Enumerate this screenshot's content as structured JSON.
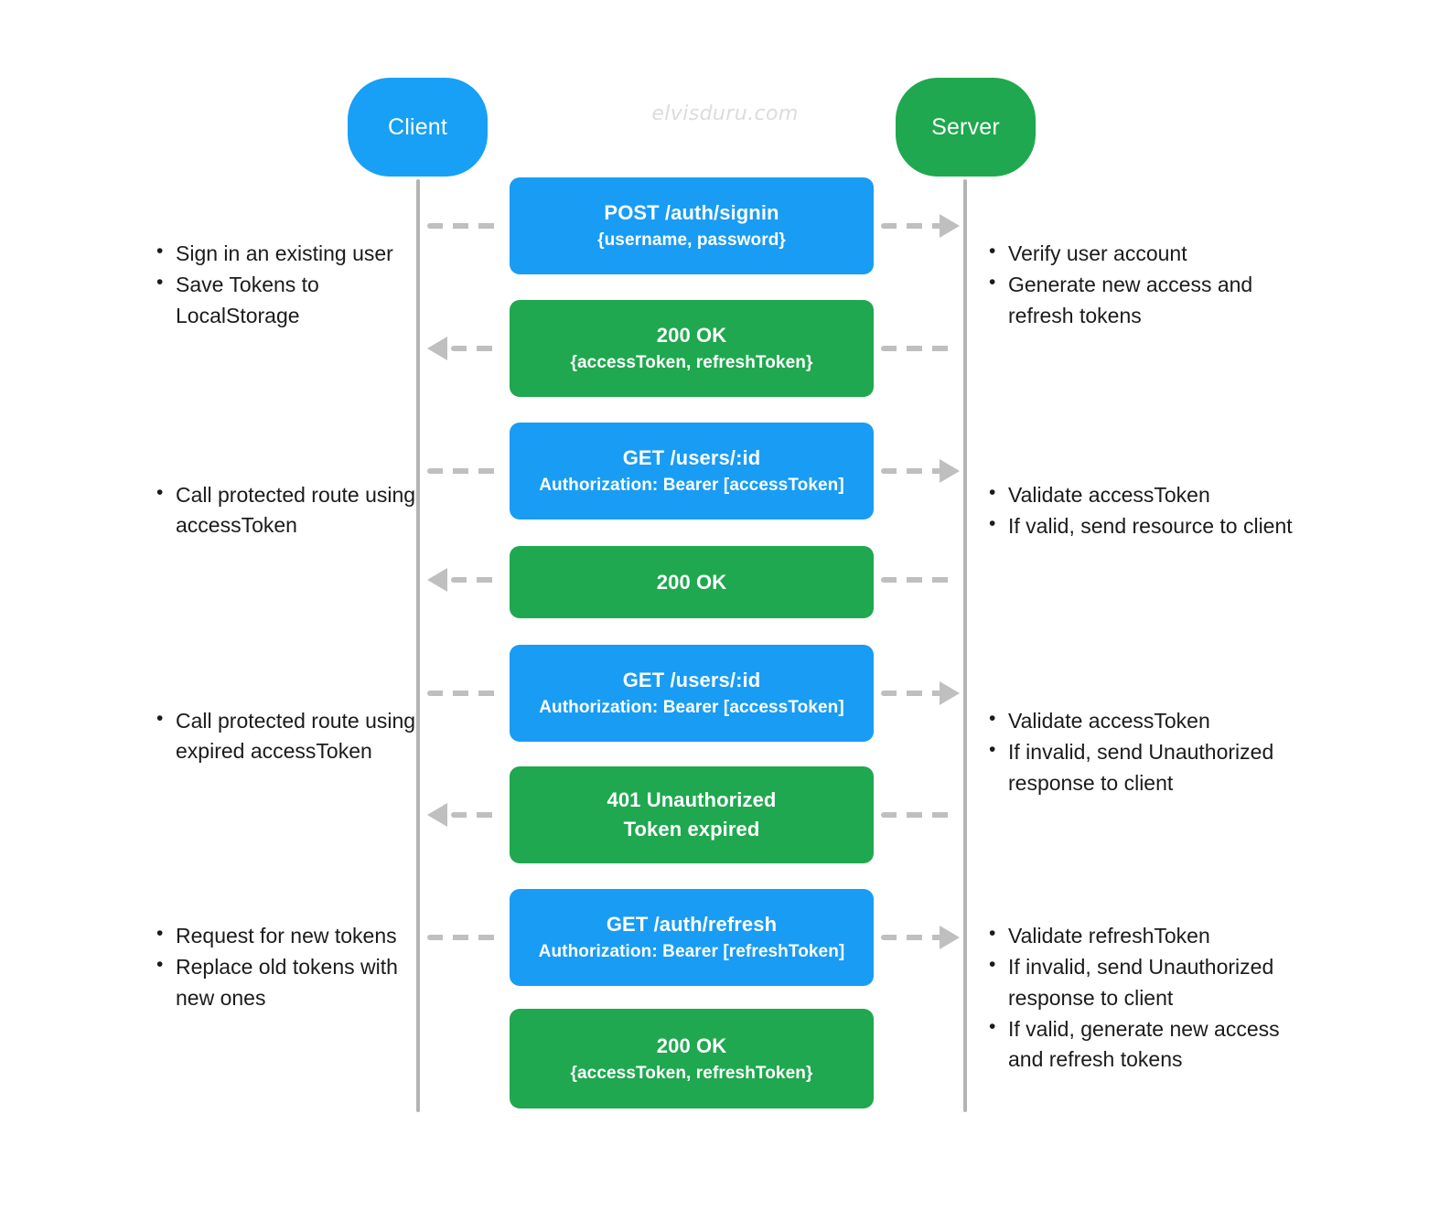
{
  "watermark": "elvisduru.com",
  "colors": {
    "client": "#17a0f5",
    "server": "#1fa84f",
    "request_box": "#199cf4",
    "response_box": "#1fa84f",
    "lifeline": "#b4b4b4",
    "arrow": "#bfbfbf",
    "text": "#1b1b1b"
  },
  "actors": {
    "client": "Client",
    "server": "Server"
  },
  "messages": [
    {
      "id": "signin-request",
      "kind": "request",
      "direction": "right",
      "line1": "POST /auth/signin",
      "line2": "{username, password}"
    },
    {
      "id": "signin-response",
      "kind": "response",
      "direction": "left",
      "line1": "200 OK",
      "line2": "{accessToken, refreshToken}"
    },
    {
      "id": "users-request-1",
      "kind": "request",
      "direction": "right",
      "line1": "GET /users/:id",
      "line2": "Authorization: Bearer [accessToken]"
    },
    {
      "id": "users-response-1",
      "kind": "response",
      "direction": "left",
      "line1": "200 OK",
      "line2": ""
    },
    {
      "id": "users-request-2",
      "kind": "request",
      "direction": "right",
      "line1": "GET /users/:id",
      "line2": "Authorization: Bearer [accessToken]"
    },
    {
      "id": "users-response-2",
      "kind": "response",
      "direction": "left",
      "line1": "401 Unauthorized",
      "line2": "Token expired"
    },
    {
      "id": "refresh-request",
      "kind": "request",
      "direction": "right",
      "line1": "GET /auth/refresh",
      "line2": "Authorization: Bearer [refreshToken]"
    },
    {
      "id": "refresh-response",
      "kind": "response",
      "direction": "left",
      "line1": "200 OK",
      "line2": "{accessToken, refreshToken}"
    }
  ],
  "client_notes": [
    {
      "id": "note-signin",
      "items": [
        "Sign in an existing user",
        "Save Tokens to LocalStorage"
      ]
    },
    {
      "id": "note-call",
      "items": [
        "Call protected route using accessToken"
      ]
    },
    {
      "id": "note-expired",
      "items": [
        "Call protected route using expired accessToken"
      ]
    },
    {
      "id": "note-refresh",
      "items": [
        "Request for new tokens",
        "Replace old tokens with new ones"
      ]
    }
  ],
  "server_notes": [
    {
      "id": "note-verify",
      "items": [
        "Verify user account",
        "Generate new access and refresh tokens"
      ]
    },
    {
      "id": "note-validate",
      "items": [
        "Validate accessToken",
        "If valid, send resource to client"
      ]
    },
    {
      "id": "note-invalid",
      "items": [
        "Validate accessToken",
        "If invalid, send Unauthorized response to client"
      ]
    },
    {
      "id": "note-rotate",
      "items": [
        "Validate refreshToken",
        "If invalid, send Unauthorized response to client",
        "If valid, generate new access and refresh tokens"
      ]
    }
  ]
}
